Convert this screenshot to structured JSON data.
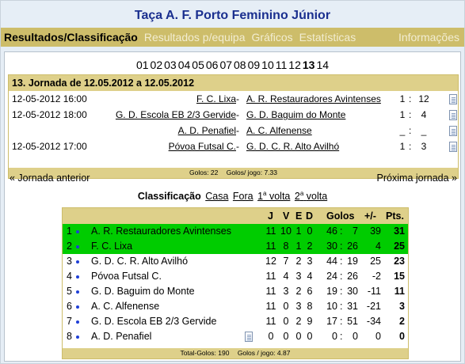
{
  "page_title": "Taça A. F. Porto Feminino Júnior",
  "menu": {
    "results": "Resultados/Classificação",
    "team_results": "Resultados p/equipa",
    "charts": "Gráficos",
    "stats": "Estatísticas",
    "info": "Informações"
  },
  "rounds": [
    "01",
    "02",
    "03",
    "04",
    "05",
    "06",
    "07",
    "08",
    "09",
    "10",
    "11",
    "12",
    "13",
    "14"
  ],
  "current_round": "13",
  "jornada": {
    "title": "13. Jornada de 12.05.2012 a 12.05.2012",
    "matches": [
      {
        "date": "12-05-2012 16:00",
        "home": "F. C. Lixa",
        "away": "A. R. Restauradores Avintenses",
        "sh": "1",
        "sep": ":",
        "sa": "12"
      },
      {
        "date": "12-05-2012 18:00",
        "home": "G. D. Escola EB 2/3 Gervide",
        "away": "G. D. Baguim do Monte",
        "sh": "1",
        "sep": ":",
        "sa": "4"
      },
      {
        "date": "",
        "home": "A. D. Penafiel",
        "away": "A. C. Alfenense",
        "sh": "_",
        "sep": ":",
        "sa": "_"
      },
      {
        "date": "12-05-2012 17:00",
        "home": "Póvoa Futsal C.",
        "away": "G. D. C. R. Alto Avilhó",
        "sh": "1",
        "sep": ":",
        "sa": "3"
      }
    ],
    "dash": "-",
    "goals": "Golos: 22",
    "goals_per_game": "Golos/ jogo: 7.33"
  },
  "nav": {
    "prev": "« Jornada anterior",
    "next": "Próxima jornada »"
  },
  "classificacao": {
    "label": "Classificação",
    "casa": "Casa",
    "fora": "Fora",
    "first": "1",
    "second": "2",
    "sup": "a",
    "volta": "volta"
  },
  "table": {
    "headers": {
      "j": "J",
      "v": "V",
      "e": "E",
      "d": "D",
      "goals": "Golos",
      "diff": "+/-",
      "pts": "Pts."
    },
    "rows": [
      {
        "pos": "1",
        "team": "A. R. Restauradores Avintenses",
        "j": "11",
        "v": "10",
        "e": "1",
        "d": "0",
        "gm": "46",
        "gs": "7",
        "dif": "39",
        "pts": "31",
        "green": true
      },
      {
        "pos": "2",
        "team": "F. C. Lixa",
        "j": "11",
        "v": "8",
        "e": "1",
        "d": "2",
        "gm": "30",
        "gs": "26",
        "dif": "4",
        "pts": "25",
        "green": true
      },
      {
        "pos": "3",
        "team": "G. D. C. R. Alto Avilhó",
        "j": "12",
        "v": "7",
        "e": "2",
        "d": "3",
        "gm": "44",
        "gs": "19",
        "dif": "25",
        "pts": "23",
        "green": false
      },
      {
        "pos": "4",
        "team": "Póvoa Futsal C.",
        "j": "11",
        "v": "4",
        "e": "3",
        "d": "4",
        "gm": "24",
        "gs": "26",
        "dif": "-2",
        "pts": "15",
        "green": false
      },
      {
        "pos": "5",
        "team": "G. D. Baguim do Monte",
        "j": "11",
        "v": "3",
        "e": "2",
        "d": "6",
        "gm": "19",
        "gs": "30",
        "dif": "-11",
        "pts": "11",
        "green": false
      },
      {
        "pos": "6",
        "team": "A. C. Alfenense",
        "j": "11",
        "v": "0",
        "e": "3",
        "d": "8",
        "gm": "10",
        "gs": "31",
        "dif": "-21",
        "pts": "3",
        "green": false
      },
      {
        "pos": "7",
        "team": "G. D. Escola EB 2/3 Gervide",
        "j": "11",
        "v": "0",
        "e": "2",
        "d": "9",
        "gm": "17",
        "gs": "51",
        "dif": "-34",
        "pts": "2",
        "green": false
      },
      {
        "pos": "8",
        "team": "A. D. Penafiel",
        "j": "0",
        "v": "0",
        "e": "0",
        "d": "0",
        "gm": "0",
        "gs": "0",
        "dif": "0",
        "pts": "0",
        "green": false,
        "doc": true
      }
    ],
    "colon": ":",
    "total_goals": "Total-Golos: 190",
    "goals_per_game": "Golos / jogo: 4.87"
  },
  "colors": {
    "menu_bg": "#cdbd6a",
    "header_bg": "#ded08a",
    "title": "#1a2f8f",
    "highlight": "#00cc00"
  }
}
